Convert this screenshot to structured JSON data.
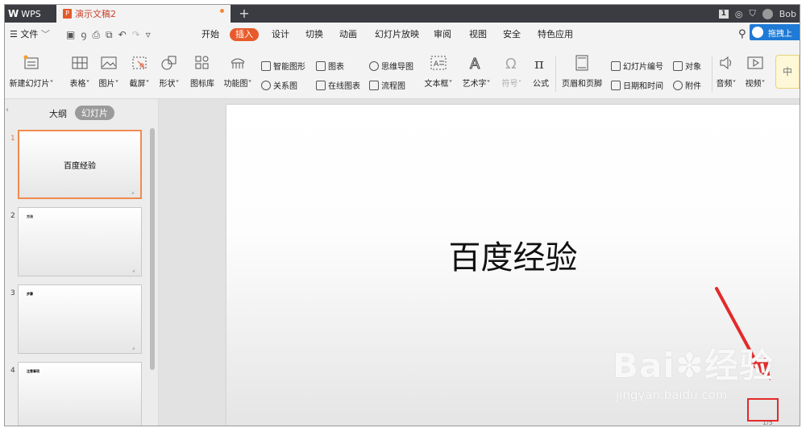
{
  "titlebar": {
    "app": "WPS",
    "doc_tab": "演示文稿2",
    "new_tab": "+",
    "page_badge": "1",
    "user": "Bob"
  },
  "menu": {
    "file": "文件",
    "items": [
      "开始",
      "插入",
      "设计",
      "切换",
      "动画",
      "幻灯片放映",
      "审阅",
      "视图",
      "安全",
      "特色应用"
    ],
    "active": "插入",
    "cloud_label": "拖拽上"
  },
  "ribbon": {
    "big": [
      {
        "label": "新建幻灯片",
        "arrow": "˅"
      },
      {
        "label": "表格",
        "arrow": "˅"
      },
      {
        "label": "图片",
        "arrow": "˅"
      },
      {
        "label": "截屏",
        "arrow": "˅"
      },
      {
        "label": "形状",
        "arrow": "˅"
      },
      {
        "label": "图标库",
        "arrow": ""
      },
      {
        "label": "功能图",
        "arrow": "˅"
      },
      {
        "label": "文本框",
        "arrow": "˅"
      },
      {
        "label": "艺术字",
        "arrow": "˅"
      },
      {
        "label": "符号",
        "arrow": "˅"
      },
      {
        "label": "公式",
        "arrow": ""
      },
      {
        "label": "页眉和页脚",
        "arrow": ""
      },
      {
        "label": "音频",
        "arrow": "˅"
      },
      {
        "label": "视频",
        "arrow": "˅"
      }
    ],
    "small": [
      "智能图形",
      "图表",
      "关系图",
      "在线图表",
      "思维导图",
      "流程图",
      "幻灯片编号",
      "对象",
      "日期和时间",
      "附件"
    ],
    "side_button": "中"
  },
  "leftpanel": {
    "tab_outline": "大纲",
    "tab_slides": "幻灯片",
    "thumbs": [
      {
        "num": "1",
        "text": "百度经验"
      },
      {
        "num": "2",
        "text": "方法"
      },
      {
        "num": "3",
        "text": "步骤"
      },
      {
        "num": "4",
        "text": "注意事项"
      }
    ]
  },
  "slide": {
    "title": "百度经验",
    "page_indicator": "1/5"
  },
  "watermark": {
    "brand": "Bai",
    "brand_tail": "经验",
    "url": "jingyan.baidu.com"
  },
  "colors": {
    "accent": "#e95a2a",
    "marker": "#e32a2a",
    "arrow": "#e32a2a"
  }
}
